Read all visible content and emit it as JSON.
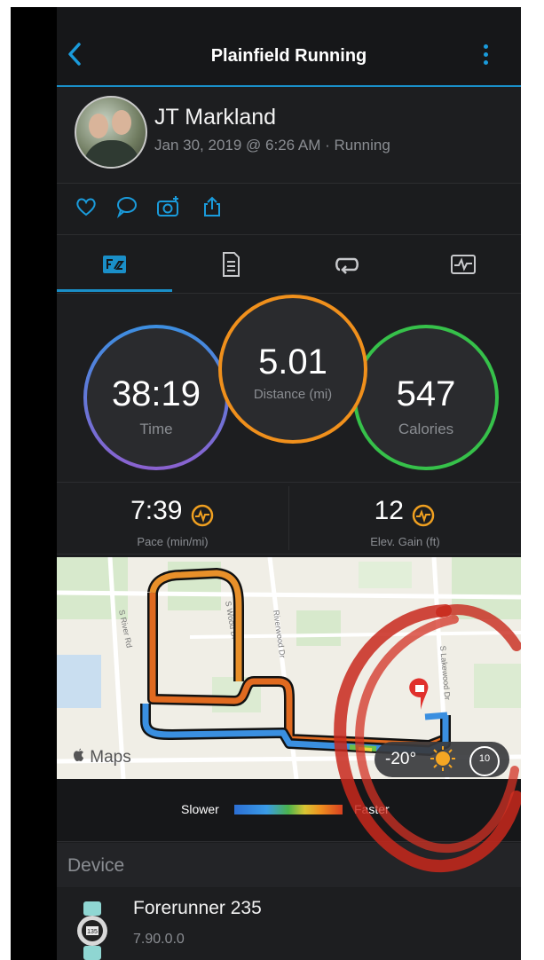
{
  "header": {
    "title": "Plainfield Running"
  },
  "activity": {
    "user_name": "JT Markland",
    "meta": "Jan 30, 2019 @ 6:26 AM · Running"
  },
  "stats": {
    "time": {
      "value": "38:19",
      "label": "Time",
      "color": "#7c6ed8"
    },
    "distance": {
      "value": "5.01",
      "label": "Distance (mi)",
      "color": "#f0901c"
    },
    "calories": {
      "value": "547",
      "label": "Calories",
      "color": "#36c14a"
    }
  },
  "summary": {
    "pace": {
      "value": "7:39",
      "label": "Pace (min/mi)"
    },
    "elevation": {
      "value": "12",
      "label": "Elev. Gain (ft)"
    }
  },
  "map": {
    "source": "Maps",
    "streets": [
      "S River Rd",
      "Riverwood Dr",
      "S Wood Dr",
      "S Lakewood Dr"
    ],
    "weather": {
      "temperature": "-20°",
      "wind": "10"
    }
  },
  "legend": {
    "slower": "Slower",
    "faster": "Faster"
  },
  "device": {
    "section_title": "Device",
    "name": "Forerunner 235",
    "version": "7.90.0.0",
    "watch_label": "135"
  },
  "colors": {
    "accent": "#1a9bdb",
    "background": "#1b1c1e",
    "pace_icon": "#f0a020"
  }
}
